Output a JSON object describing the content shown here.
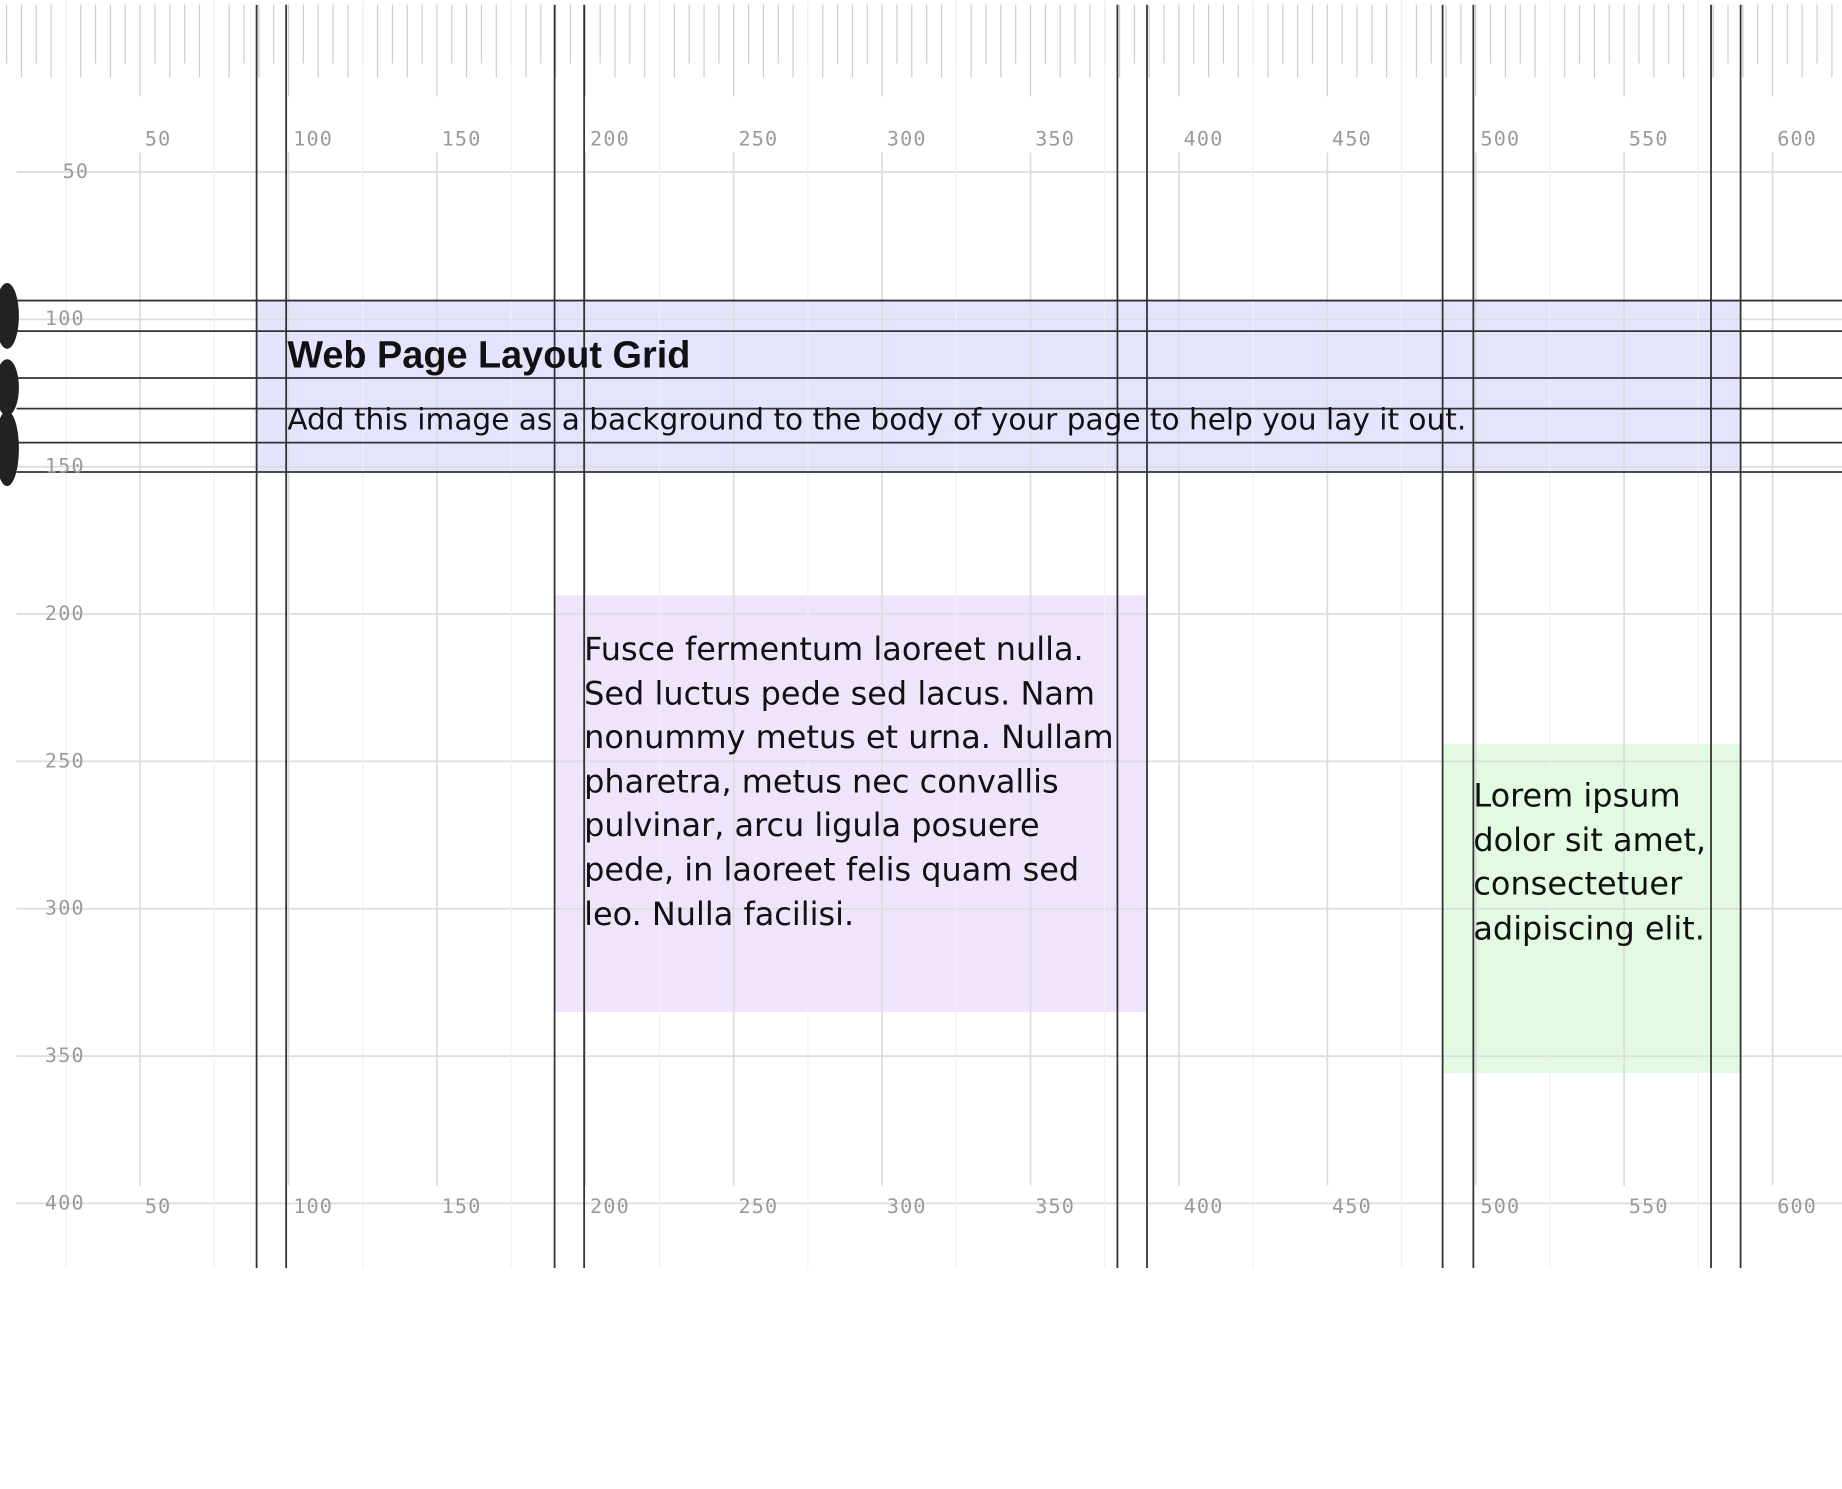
{
  "ruler": {
    "top_labels": [
      "50",
      "100",
      "150",
      "200",
      "250",
      "300",
      "350",
      "400",
      "450",
      "500",
      "550",
      "600"
    ],
    "bottom_labels": [
      "50",
      "100",
      "150",
      "200",
      "250",
      "300",
      "350",
      "400",
      "450",
      "500",
      "550",
      "600"
    ],
    "left_labels": [
      "50",
      "100",
      "150",
      "200",
      "250",
      "300",
      "350",
      "400"
    ]
  },
  "header": {
    "title": "Web Page Layout Grid",
    "subtitle": "Add this image as a background to the body of your page to help you lay it out."
  },
  "content": {
    "text": "Fusce fermentum laoreet nulla. Sed luctus pede sed lacus. Nam nonummy metus et urna. Nullam pharetra, metus nec convallis pulvinar, arcu ligula posuere pede, in laoreet felis quam sed leo. Nulla facilisi."
  },
  "aside": {
    "text": "Lorem ipsum dolor sit amet, consectetuer adipiscing elit."
  },
  "colors": {
    "header_band": "#d6d6ff",
    "content_band": "#eedcfb",
    "aside_band": "#d8f6d8",
    "major_line": "#333333",
    "minor_line": "#dddddd"
  }
}
